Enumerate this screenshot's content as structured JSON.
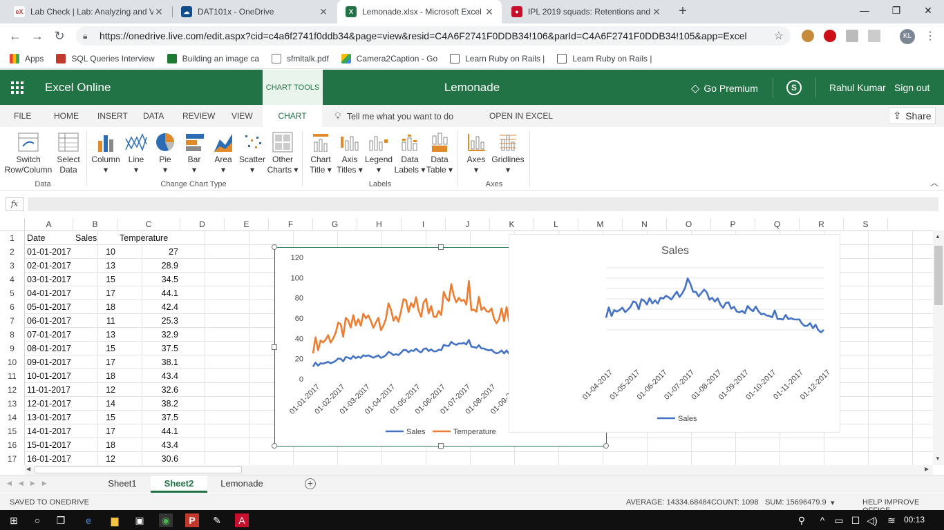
{
  "browser": {
    "tabs": [
      {
        "title": "Lab Check | Lab: Analyzing and V",
        "icon": "edx-icon",
        "color": "#c0392b"
      },
      {
        "title": "DAT101x - OneDrive",
        "icon": "onedrive-icon",
        "color": "#0f4c8a"
      },
      {
        "title": "Lemonade.xlsx - Microsoft Excel C",
        "icon": "excel-icon",
        "color": "#217346"
      },
      {
        "title": "IPL 2019 squads: Retentions and",
        "icon": "news-icon",
        "color": "#c8102e"
      }
    ],
    "url": "https://onedrive.live.com/edit.aspx?cid=c4a6f2741f0ddb34&page=view&resid=C4A6F2741F0DDB34!106&parId=C4A6F2741F0DDB34!105&app=Excel",
    "avatar": "KL",
    "bookmarks": [
      "Apps",
      "SQL Queries Interview",
      "Building an image ca",
      "sfmltalk.pdf",
      "Camera2Caption - Go",
      "Learn Ruby on Rails |",
      "Learn Ruby on Rails |"
    ]
  },
  "excel": {
    "app_name": "Excel Online",
    "chart_tools": "CHART TOOLS",
    "doc_name": "Lemonade",
    "go_premium": "Go Premium",
    "user": "Rahul Kumar",
    "sign_out": "Sign out",
    "accent": "#217346",
    "ribbon_tabs": [
      "FILE",
      "HOME",
      "INSERT",
      "DATA",
      "REVIEW",
      "VIEW",
      "CHART"
    ],
    "tell_me": "Tell me what you want to do",
    "open_in_excel": "OPEN IN EXCEL",
    "share": "Share",
    "ribbon": {
      "buttons": [
        {
          "l1": "Switch",
          "l2": "Row/Column"
        },
        {
          "l1": "Select",
          "l2": "Data"
        },
        {
          "l1": "Column",
          "l2": "▾"
        },
        {
          "l1": "Line",
          "l2": "▾"
        },
        {
          "l1": "Pie",
          "l2": "▾"
        },
        {
          "l1": "Bar",
          "l2": "▾"
        },
        {
          "l1": "Area",
          "l2": "▾"
        },
        {
          "l1": "Scatter",
          "l2": "▾"
        },
        {
          "l1": "Other",
          "l2": "Charts ▾"
        },
        {
          "l1": "Chart",
          "l2": "Title ▾"
        },
        {
          "l1": "Axis",
          "l2": "Titles ▾"
        },
        {
          "l1": "Legend",
          "l2": "▾"
        },
        {
          "l1": "Data",
          "l2": "Labels ▾"
        },
        {
          "l1": "Data",
          "l2": "Table ▾"
        },
        {
          "l1": "Axes",
          "l2": "▾"
        },
        {
          "l1": "Gridlines",
          "l2": "▾"
        }
      ],
      "groups": [
        "Data",
        "Change Chart Type",
        "Labels",
        "Axes"
      ]
    },
    "fx_label": "fx",
    "columns": [
      "A",
      "B",
      "C",
      "D",
      "E",
      "F",
      "G",
      "H",
      "I",
      "J",
      "K",
      "L",
      "M",
      "N",
      "O",
      "P",
      "Q",
      "R",
      "S"
    ],
    "rows": [
      [
        "Date",
        "Sales",
        "Temperature"
      ],
      [
        "01-01-2017",
        "10",
        "27"
      ],
      [
        "02-01-2017",
        "13",
        "28.9"
      ],
      [
        "03-01-2017",
        "15",
        "34.5"
      ],
      [
        "04-01-2017",
        "17",
        "44.1"
      ],
      [
        "05-01-2017",
        "18",
        "42.4"
      ],
      [
        "06-01-2017",
        "11",
        "25.3"
      ],
      [
        "07-01-2017",
        "13",
        "32.9"
      ],
      [
        "08-01-2017",
        "15",
        "37.5"
      ],
      [
        "09-01-2017",
        "17",
        "38.1"
      ],
      [
        "10-01-2017",
        "18",
        "43.4"
      ],
      [
        "11-01-2017",
        "12",
        "32.6"
      ],
      [
        "12-01-2017",
        "14",
        "38.2"
      ],
      [
        "13-01-2017",
        "15",
        "37.5"
      ],
      [
        "14-01-2017",
        "17",
        "44.1"
      ],
      [
        "15-01-2017",
        "18",
        "43.4"
      ],
      [
        "16-01-2017",
        "12",
        "30.6"
      ]
    ],
    "sheets": [
      "Sheet1",
      "Sheet2",
      "Lemonade"
    ],
    "active_sheet": "Sheet2",
    "status": {
      "saved": "SAVED TO ONEDRIVE",
      "average": "AVERAGE: 14334.68484",
      "count": "COUNT: 1098",
      "sum": "SUM: 15696479.9",
      "help": "HELP IMPROVE OFFICE"
    }
  },
  "chart_data": [
    {
      "type": "line",
      "title": "",
      "x": [
        "01-01-2017",
        "01-02-2017",
        "01-03-2017",
        "01-04-2017",
        "01-05-2017",
        "01-06-2017",
        "01-07-2017",
        "01-08-2017",
        "01-09-2017",
        "01-10-2017",
        "01-11-2017",
        "01-12-2017"
      ],
      "series": [
        {
          "name": "Sales",
          "color": "#4472c4",
          "values": [
            14,
            18,
            22,
            24,
            27,
            30,
            38,
            29,
            26,
            24,
            21,
            15
          ]
        },
        {
          "name": "Temperature",
          "color": "#ed7d31",
          "values": [
            33,
            46,
            58,
            62,
            68,
            73,
            90,
            70,
            64,
            58,
            50,
            36
          ]
        }
      ],
      "yticks": [
        "0",
        "20",
        "40",
        "60",
        "80",
        "100",
        "120"
      ],
      "ylim": [
        0,
        120
      ],
      "legend": "bottom",
      "grid": false
    },
    {
      "type": "line",
      "title": "Sales",
      "x": [
        "01-04-2017",
        "01-05-2017",
        "01-06-2017",
        "01-07-2017",
        "01-08-2017",
        "01-09-2017",
        "01-10-2017",
        "01-11-2017",
        "01-12-2017"
      ],
      "series": [
        {
          "name": "Sales",
          "color": "#4472c4",
          "values": [
            24,
            27,
            30,
            38,
            29,
            26,
            24,
            21,
            15
          ]
        }
      ],
      "legend": "bottom",
      "grid": true
    }
  ],
  "taskbar": {
    "time": "00:13"
  }
}
